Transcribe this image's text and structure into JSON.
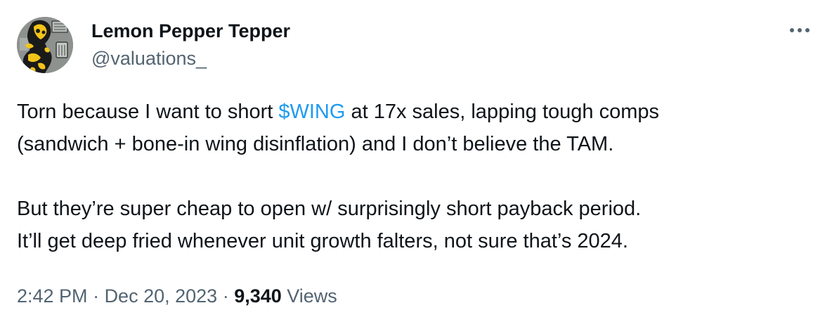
{
  "author": {
    "display_name": "Lemon Pepper Tepper",
    "handle": "@valuations_",
    "avatar_icon": "cartoon-character-avatar"
  },
  "tweet": {
    "line1_before": "Torn because I want to short ",
    "cashtag": "$WING",
    "line1_after": " at 17x sales, lapping tough comps",
    "line2": "(sandwich + bone-in wing disinflation) and I don’t believe the TAM.",
    "line3": "But they’re super cheap to open w/ surprisingly short payback period.",
    "line4": "It’ll get deep fried whenever unit growth falters, not sure that’s 2024."
  },
  "meta": {
    "time": "2:42 PM",
    "separator1": " · ",
    "date": "Dec 20, 2023",
    "separator2": " · ",
    "views_count": "9,340",
    "views_label": " Views"
  },
  "icons": {
    "more": "more-horizontal-icon"
  },
  "colors": {
    "text": "#0f1419",
    "secondary": "#536471",
    "link": "#1d9bf0"
  }
}
